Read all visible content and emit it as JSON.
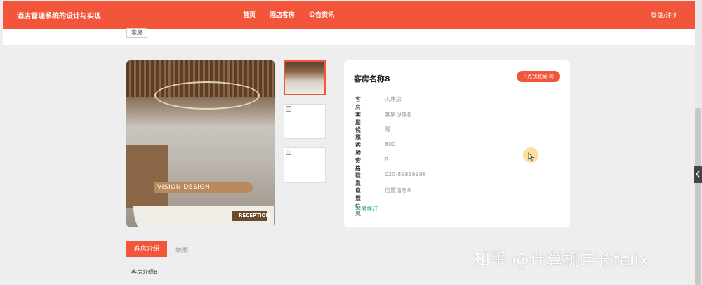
{
  "header": {
    "site_title": "酒店管理系统的设计与实现",
    "nav": [
      "首页",
      "酒店客房",
      "公告资讯"
    ],
    "login": "登录/注册"
  },
  "breadcrumb": "客房",
  "room": {
    "title": "客房名称8",
    "favorite_label": "点我收藏(8)",
    "fields": [
      {
        "label": "客房类型",
        "value": "大床房"
      },
      {
        "label": "客房设施",
        "value": "客房设施8"
      },
      {
        "label": "优惠活动",
        "value": "是"
      },
      {
        "label": "客房价格",
        "value": "800"
      },
      {
        "label": "客房数量",
        "value": "8"
      },
      {
        "label": "联系电话",
        "value": "020-89819998"
      },
      {
        "label": "位置信息",
        "value": "位置信息8"
      }
    ],
    "book_label": "客房预订"
  },
  "image": {
    "sign": "VISION DESIGN",
    "desk": "RECEPTION"
  },
  "tabs": {
    "intro": "客房介绍",
    "map": "地图"
  },
  "intro_text": "客房介绍8",
  "watermark": "知乎 @计算机学长felix",
  "colors": {
    "accent": "#f2553a",
    "link": "#1aa37a"
  }
}
